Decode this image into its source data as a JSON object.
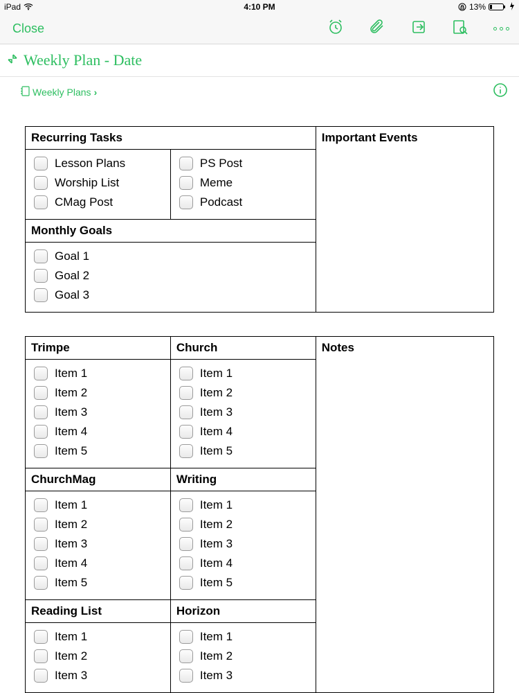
{
  "status": {
    "device": "iPad",
    "time": "4:10 PM",
    "battery": "13%"
  },
  "toolbar": {
    "close": "Close"
  },
  "title": "Weekly Plan - Date",
  "breadcrumb": "Weekly Plans",
  "table1": {
    "recurring": {
      "header": "Recurring Tasks",
      "colA": [
        "Lesson Plans",
        "Worship List",
        "CMag Post"
      ],
      "colB": [
        "PS Post",
        "Meme",
        "Podcast"
      ]
    },
    "monthly": {
      "header": "Monthly Goals",
      "items": [
        "Goal 1",
        "Goal 2",
        "Goal 3"
      ]
    },
    "events": {
      "header": "Important Events"
    }
  },
  "table2": {
    "notes": {
      "header": "Notes"
    },
    "sections": [
      {
        "a_header": "Trimpe",
        "a_items": [
          "Item 1",
          "Item 2",
          "Item 3",
          "Item 4",
          "Item 5"
        ],
        "b_header": "Church",
        "b_items": [
          "Item 1",
          "Item 2",
          "Item 3",
          "Item 4",
          "Item 5"
        ]
      },
      {
        "a_header": "ChurchMag",
        "a_items": [
          "Item 1",
          "Item 2",
          "Item 3",
          "Item 4",
          "Item 5"
        ],
        "b_header": "Writing",
        "b_items": [
          "Item 1",
          "Item 2",
          "Item 3",
          "Item 4",
          "Item 5"
        ]
      },
      {
        "a_header": "Reading List",
        "a_items": [
          "Item 1",
          "Item 2",
          "Item 3"
        ],
        "b_header": "Horizon",
        "b_items": [
          "Item 1",
          "Item 2",
          "Item 3"
        ]
      }
    ]
  }
}
